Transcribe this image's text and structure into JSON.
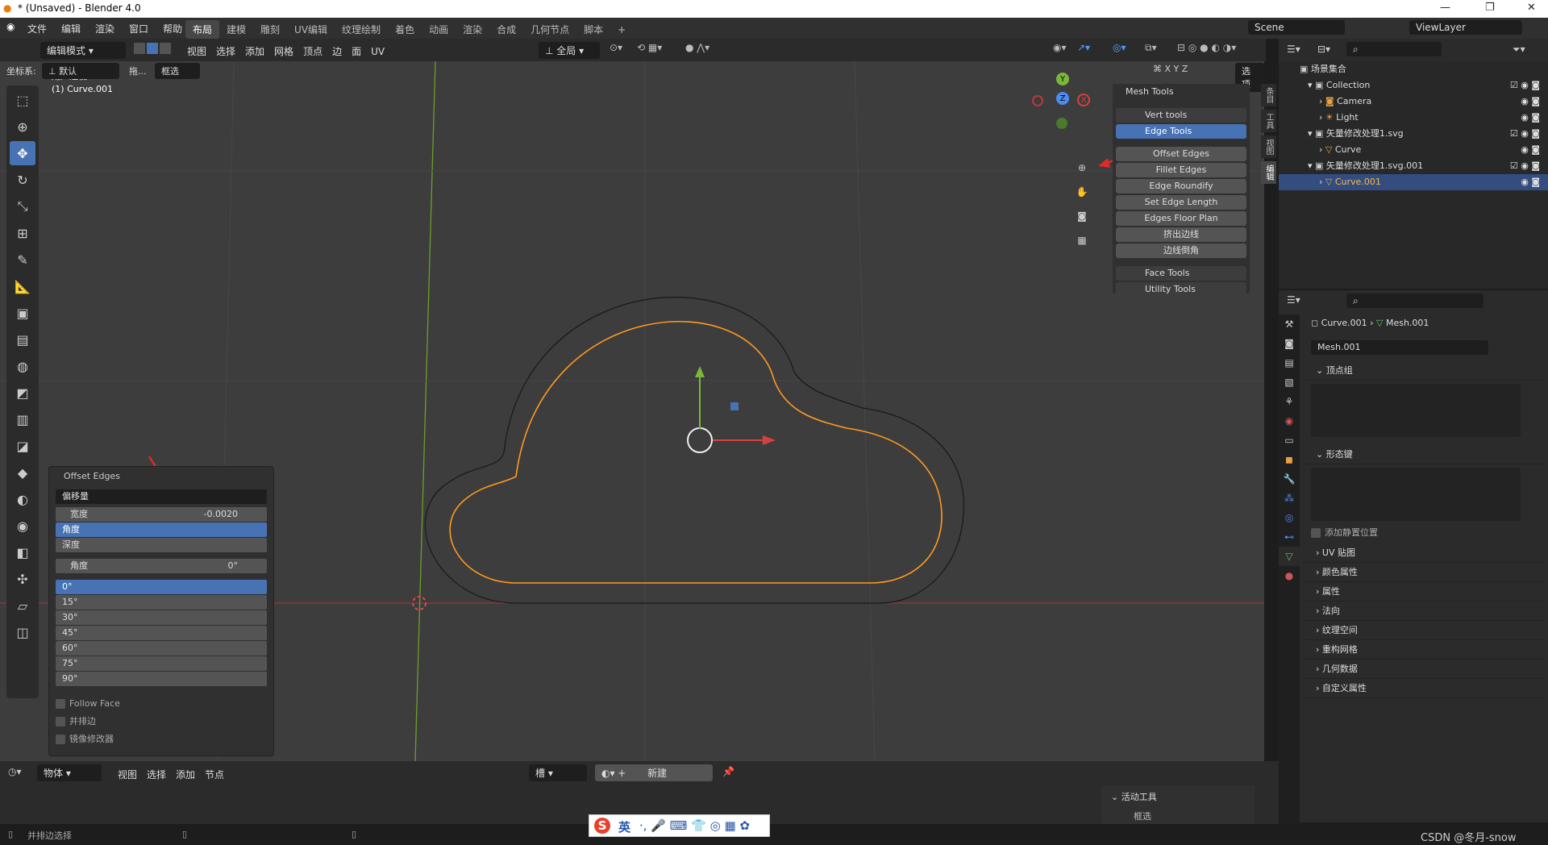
{
  "titlebar": {
    "title": "* (Unsaved) - Blender 4.0",
    "minimize": "—",
    "maximize": "❐",
    "close": "✕"
  },
  "menus": [
    "文件",
    "编辑",
    "渲染",
    "窗口",
    "帮助"
  ],
  "workspaces": [
    "布局",
    "建模",
    "雕刻",
    "UV编辑",
    "纹理绘制",
    "着色",
    "动画",
    "渲染",
    "合成",
    "几何节点",
    "脚本",
    "+"
  ],
  "scene": "Scene",
  "view_layer": "ViewLayer",
  "header": {
    "mode": "编辑模式",
    "menus": [
      "视图",
      "选择",
      "添加",
      "网格",
      "顶点",
      "边",
      "面",
      "UV"
    ],
    "orientation": "全局",
    "coord_label": "坐标系:",
    "coord_value": "默认",
    "drag_label": "拖...",
    "select_mode": "框选",
    "axes": [
      "X",
      "Y",
      "Z"
    ],
    "options": "选项"
  },
  "viewport": {
    "view_name": "用户透视",
    "object_name": "(1) Curve.001",
    "gizmo": {
      "x": "X",
      "y": "Y",
      "z": "Z"
    }
  },
  "mesh_tools": {
    "title": "Mesh Tools",
    "vert_tools": "Vert tools",
    "edge_tools": "Edge Tools",
    "edge_items": [
      "Offset Edges",
      "Fillet Edges",
      "Edge Roundify",
      "Set Edge Length",
      "Edges Floor Plan",
      "挤出边线",
      "边线倒角"
    ],
    "face_tools": "Face Tools",
    "utility_tools": "Utility Tools",
    "ntabs": [
      "条目",
      "工具",
      "视图",
      "编辑"
    ]
  },
  "operator": {
    "title": "Offset Edges",
    "mode": "偏移量",
    "width_label": "宽度",
    "width_value": "-0.0020",
    "options": [
      "角度",
      "深度"
    ],
    "angle_label": "角度",
    "angle_value": "0°",
    "angles": [
      "0°",
      "15°",
      "30°",
      "45°",
      "60°",
      "75°",
      "90°"
    ],
    "checks": [
      "Follow Face",
      "并排边",
      "镜像修改器"
    ]
  },
  "outliner": {
    "root": "场景集合",
    "rows": [
      {
        "label": "Collection",
        "indent": 1
      },
      {
        "label": "Camera",
        "indent": 2
      },
      {
        "label": "Light",
        "indent": 2
      },
      {
        "label": "矢量修改处理1.svg",
        "indent": 1
      },
      {
        "label": "Curve",
        "indent": 2
      },
      {
        "label": "矢量修改处理1.svg.001",
        "indent": 1
      },
      {
        "label": "Curve.001",
        "indent": 2,
        "selected": true
      }
    ]
  },
  "properties": {
    "breadcrumb_obj": "Curve.001",
    "breadcrumb_mesh": "Mesh.001",
    "mesh_name": "Mesh.001",
    "vertex_groups": "顶点组",
    "shape_keys": "形态键",
    "relative": "添加静置位置",
    "panels": [
      "UV 贴图",
      "颜色属性",
      "属性",
      "法向",
      "纹理空间",
      "重构网格",
      "几何数据",
      "自定义属性"
    ]
  },
  "timeline": {
    "mode": "物体",
    "menus": [
      "视图",
      "选择",
      "添加",
      "节点"
    ],
    "slot": "槽",
    "new": "新建",
    "active_tool": "活动工具",
    "select_box": "框选"
  },
  "statusbar": {
    "text": "并排边选择",
    "watermark": "CSDN @冬月-snow"
  },
  "ime": {
    "label": "英"
  },
  "colors": {
    "accent": "#4772b3",
    "curve_orange": "#ff9a1f",
    "x_axis": "#d84040",
    "y_axis": "#7ab83a"
  }
}
